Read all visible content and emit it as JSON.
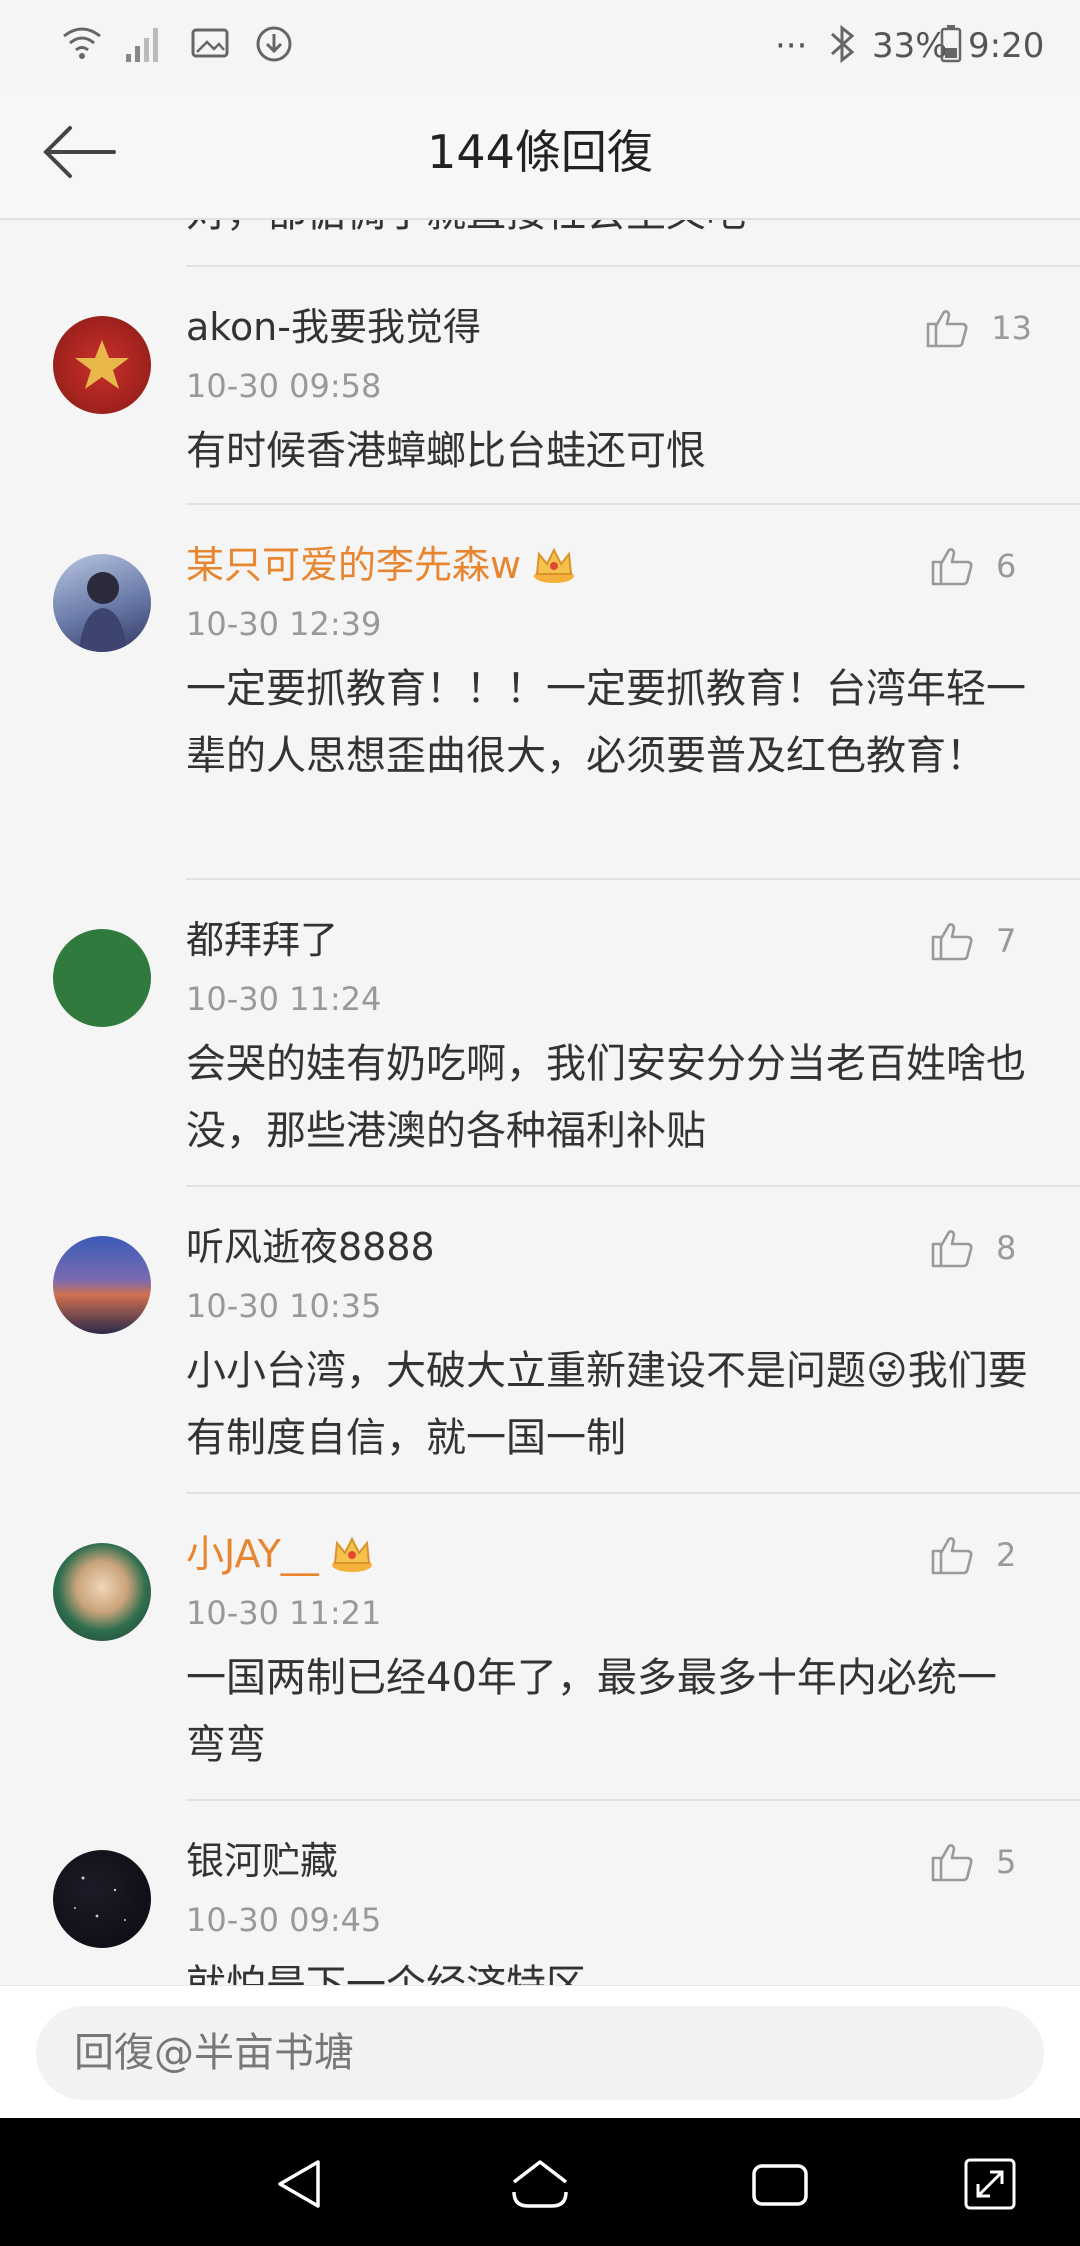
{
  "status_bar": {
    "battery": "33%",
    "time": "9:20",
    "dots": "···"
  },
  "header": {
    "title": "144條回復"
  },
  "partial_top_text": "对，都惦惆了就直接社会主义吧",
  "comments": [
    {
      "username": "akon-我要我觉得",
      "vip": false,
      "time": "10-30 09:58",
      "content": "有时候香港蟑螂比台蛙还可恨",
      "likes": "13"
    },
    {
      "username": "某只可爱的李先森w",
      "vip": true,
      "time": "10-30 12:39",
      "content": "一定要抓教育！！！一定要抓教育！台湾年轻一辈的人思想歪曲很大，必须要普及红色教育！",
      "likes": "6"
    },
    {
      "username": "都拜拜了",
      "vip": false,
      "time": "10-30 11:24",
      "content": "会哭的娃有奶吃啊，我们安安分分当老百姓啥也没，那些港澳的各种福利补贴",
      "likes": "7"
    },
    {
      "username": "听风逝夜8888",
      "vip": false,
      "time": "10-30 10:35",
      "content": "小小台湾，大破大立重新建设不是问题😜我们要有制度自信，就一国一制",
      "likes": "8"
    },
    {
      "username": "小JAY__",
      "vip": true,
      "time": "10-30 11:21",
      "content": "一国两制已经40年了，最多最多十年内必统一弯弯",
      "likes": "2"
    },
    {
      "username": "银河贮藏",
      "vip": false,
      "time": "10-30 09:45",
      "content": "就怕是下一个经济特区",
      "likes": "5"
    }
  ],
  "reply": {
    "placeholder": "回復@半亩书塘"
  },
  "colors": {
    "vip_name": "#e8852f",
    "muted": "#999999",
    "background": "#f5f5f5"
  },
  "icons": {
    "like": "thumbs-up-icon",
    "back": "back-arrow-icon",
    "crown": "crown-icon"
  }
}
